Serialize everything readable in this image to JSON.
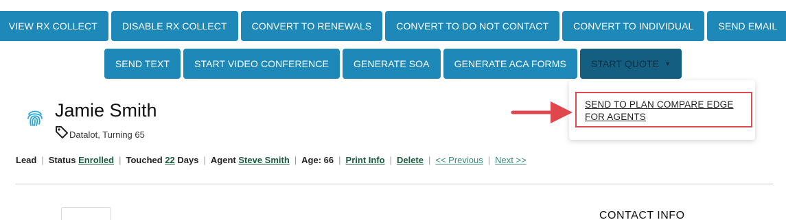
{
  "toolbar": {
    "row1": [
      "VIEW RX COLLECT",
      "DISABLE RX COLLECT",
      "CONVERT TO RENEWALS",
      "CONVERT TO DO NOT CONTACT",
      "CONVERT TO INDIVIDUAL",
      "SEND EMAIL"
    ],
    "row2": [
      "SEND TEXT",
      "START VIDEO CONFERENCE",
      "GENERATE SOA",
      "GENERATE ACA FORMS"
    ],
    "start_quote": "START QUOTE"
  },
  "dropdown": {
    "item": "SEND TO PLAN COMPARE EDGE FOR AGENTS"
  },
  "contact": {
    "name": "Jamie Smith",
    "tags": "Datalot, Turning 65"
  },
  "info": {
    "lead": "Lead",
    "status_label": "Status",
    "status_value": "Enrolled",
    "touched_label": "Touched",
    "touched_days": "22",
    "days_label": "Days",
    "agent_label": "Agent",
    "agent_value": "Steve Smith",
    "age": "Age: 66",
    "print_info": "Print Info",
    "delete": "Delete",
    "previous": "<< Previous",
    "next": "Next >>"
  },
  "contact_info_heading": "CONTACT INFO",
  "colors": {
    "button": "#1e88b8",
    "button_active": "#145e82",
    "highlight": "#e0474c",
    "link": "#1a5a3c"
  }
}
